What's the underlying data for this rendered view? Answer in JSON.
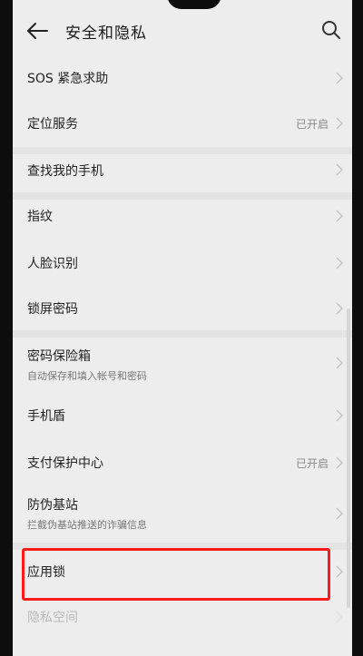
{
  "header": {
    "title": "安全和隐私"
  },
  "items": [
    {
      "label": "SOS 紧急求助",
      "sub": "",
      "value": ""
    },
    {
      "label": "定位服务",
      "sub": "",
      "value": "已开启"
    },
    {
      "label": "查找我的手机",
      "sub": "",
      "value": ""
    },
    {
      "label": "指纹",
      "sub": "",
      "value": ""
    },
    {
      "label": "人脸识别",
      "sub": "",
      "value": ""
    },
    {
      "label": "锁屏密码",
      "sub": "",
      "value": ""
    },
    {
      "label": "密码保险箱",
      "sub": "自动保存和填入帐号和密码",
      "value": ""
    },
    {
      "label": "手机盾",
      "sub": "",
      "value": ""
    },
    {
      "label": "支付保护中心",
      "sub": "",
      "value": "已开启"
    },
    {
      "label": "防伪基站",
      "sub": "拦截伪基站推送的诈骗信息",
      "value": ""
    },
    {
      "label": "应用锁",
      "sub": "",
      "value": ""
    },
    {
      "label": "隐私空间",
      "sub": "",
      "value": ""
    }
  ],
  "colors": {
    "highlight": "#ff1a1a",
    "background": "#ededed"
  }
}
